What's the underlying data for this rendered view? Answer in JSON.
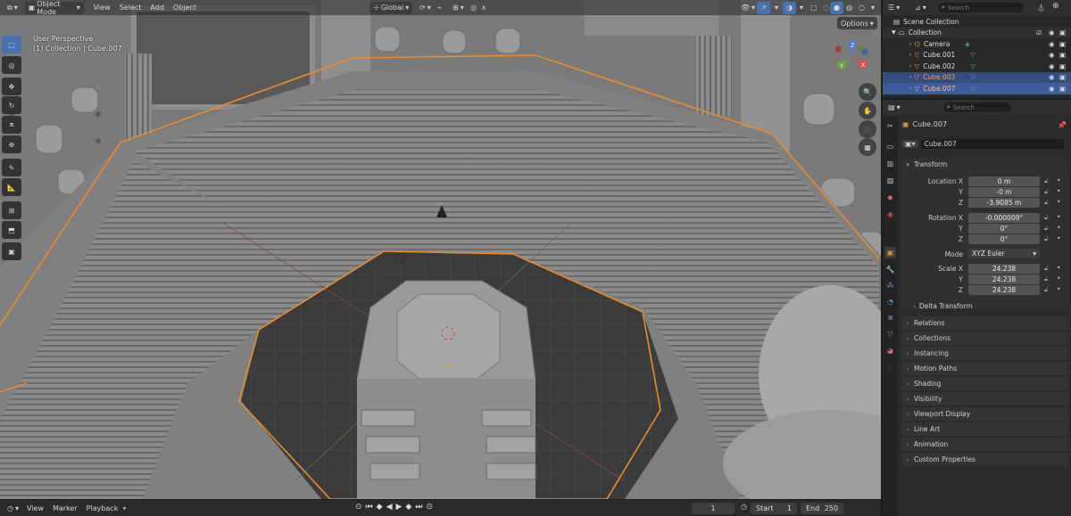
{
  "header": {
    "mode": "Object Mode",
    "menus": [
      "View",
      "Select",
      "Add",
      "Object"
    ],
    "orientation": "Global",
    "options": "Options"
  },
  "viewport": {
    "perspective": "User Perspective",
    "context": "(1) Collection | Cube.007",
    "gizmo": {
      "x": "X",
      "y": "Y",
      "z": "Z"
    }
  },
  "timeline": {
    "menus": [
      "View",
      "Marker",
      "Playback"
    ],
    "current_frame": "1",
    "start_label": "Start",
    "start": "1",
    "end_label": "End",
    "end": "250"
  },
  "outliner": {
    "search_placeholder": "Search",
    "scene_collection": "Scene Collection",
    "collection": "Collection",
    "items": [
      {
        "name": "Camera",
        "type": "camera"
      },
      {
        "name": "Cube.001",
        "type": "mesh"
      },
      {
        "name": "Cube.002",
        "type": "mesh"
      },
      {
        "name": "Cube.003",
        "type": "mesh",
        "state": "selected"
      },
      {
        "name": "Cube.007",
        "type": "mesh",
        "state": "active"
      }
    ]
  },
  "properties": {
    "search_placeholder": "Search",
    "object_name": "Cube.007",
    "object_field": "Cube.007",
    "transform_title": "Transform",
    "location": {
      "label_x": "Location X",
      "x": "0 m",
      "y": "-0 m",
      "z": "-3.9085 m"
    },
    "rotation": {
      "label_x": "Rotation X",
      "x": "-0.000009°",
      "y": "0°",
      "z": "0°"
    },
    "mode_label": "Mode",
    "mode_value": "XYZ Euler",
    "scale": {
      "label_x": "Scale X",
      "x": "24.238",
      "y": "24.238",
      "z": "24.238"
    },
    "axis_y": "Y",
    "axis_z": "Z",
    "delta_transform": "Delta Transform",
    "panels": [
      "Relations",
      "Collections",
      "Instancing",
      "Motion Paths",
      "Shading",
      "Visibility",
      "Viewport Display",
      "Line Art",
      "Animation",
      "Custom Properties"
    ]
  },
  "colors": {
    "accent": "#4772b3",
    "selection_outline": "#f08a24",
    "active_row": "#3d5c99"
  }
}
